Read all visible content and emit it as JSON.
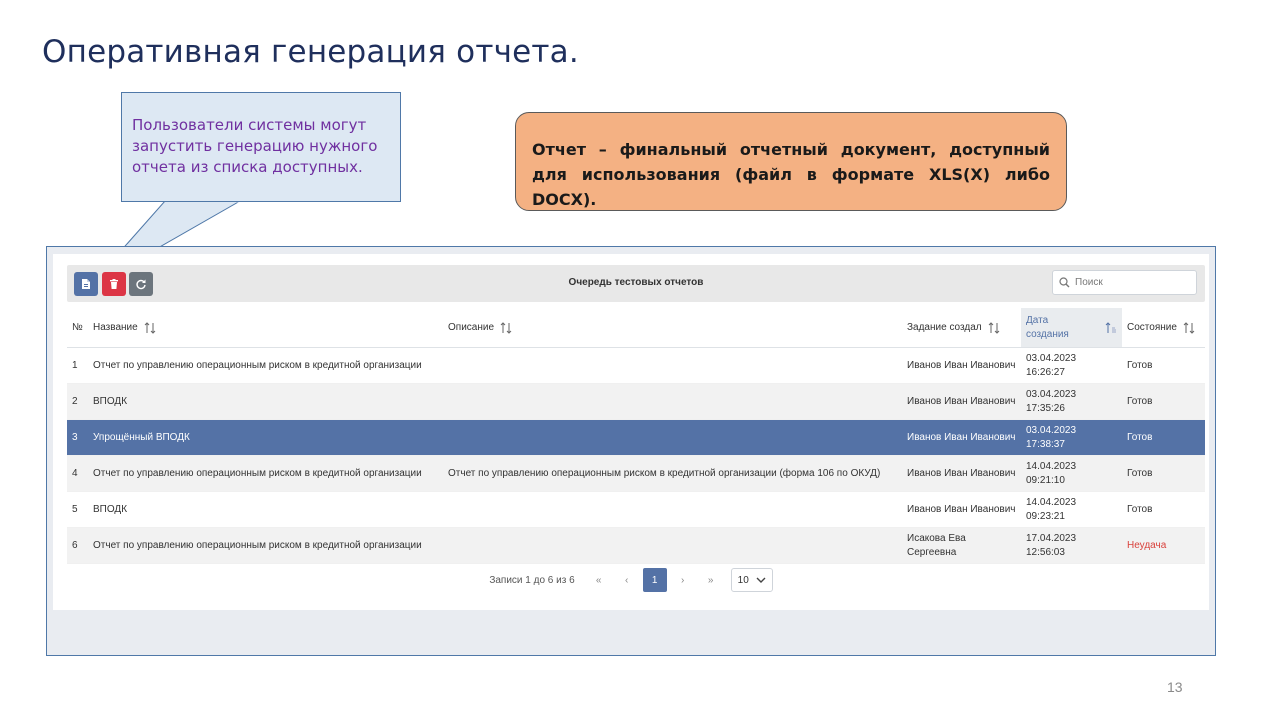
{
  "slide": {
    "title": "Оперативная генерация отчета.",
    "callout_text": "Пользователи системы могут запустить генерацию  нужного отчета из списка доступных.",
    "definition_text": "Отчет – финальный отчетный документ, доступный для использования  (файл в формате XLS(X) либо DOCX).",
    "page_number": "13",
    "colors": {
      "title": "#1f2f5c",
      "callout_text": "#7030a0",
      "definition_bg": "#f4b183"
    }
  },
  "app": {
    "toolbar": {
      "title": "Очередь тестовых отчетов",
      "buttons": [
        {
          "icon": "file-report-icon",
          "color": "#5472a6"
        },
        {
          "icon": "trash-icon",
          "color": "#dc3545"
        },
        {
          "icon": "refresh-icon",
          "color": "#6c757d"
        }
      ],
      "search_placeholder": "Поиск"
    },
    "columns": {
      "num": "№",
      "name": "Название",
      "description": "Описание",
      "created_by": "Задание создал",
      "created_date": "Дата создания",
      "status": "Состояние"
    },
    "rows": [
      {
        "num": "1",
        "name": "Отчет по управлению операционным риском в кредитной организации",
        "description": "",
        "created_by": "Иванов Иван Иванович",
        "date": "03.04.2023 16:26:27",
        "status": "Готов"
      },
      {
        "num": "2",
        "name": "ВПОДК",
        "description": "",
        "created_by": "Иванов Иван Иванович",
        "date": "03.04.2023 17:35:26",
        "status": "Готов"
      },
      {
        "num": "3",
        "name": "Упрощённый ВПОДК",
        "description": "",
        "created_by": "Иванов Иван Иванович",
        "date": "03.04.2023 17:38:37",
        "status": "Готов"
      },
      {
        "num": "4",
        "name": "Отчет по управлению операционным риском в кредитной организации",
        "description": "Отчет по управлению операционным риском в кредитной организации (форма 106 по ОКУД)",
        "created_by": "Иванов Иван Иванович",
        "date": "14.04.2023 09:21:10",
        "status": "Готов"
      },
      {
        "num": "5",
        "name": "ВПОДК",
        "description": "",
        "created_by": "Иванов Иван Иванович",
        "date": "14.04.2023 09:23:21",
        "status": "Готов"
      },
      {
        "num": "6",
        "name": "Отчет по управлению операционным риском в кредитной организации",
        "description": "",
        "created_by": "Исакова Ева Сергеевна",
        "date": "17.04.2023 12:56:03",
        "status": "Неудача"
      }
    ],
    "selected_row": "3",
    "pagination": {
      "info": "Записи 1 до 6 из 6",
      "first": "«",
      "prev": "‹",
      "current_page": "1",
      "next": "›",
      "last": "»",
      "page_size": "10"
    }
  }
}
